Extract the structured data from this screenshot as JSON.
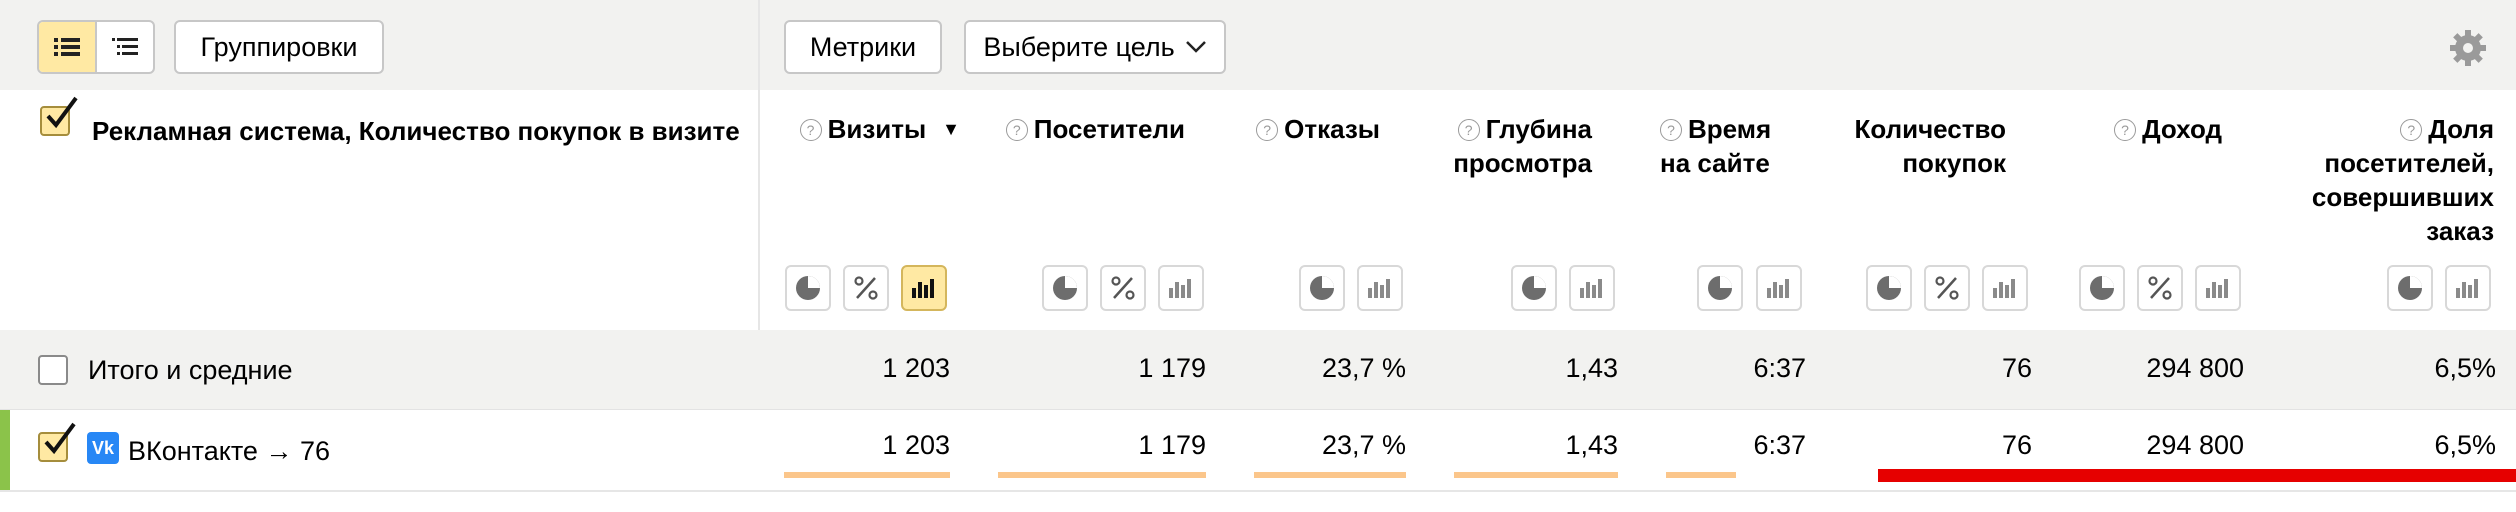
{
  "toolbar": {
    "view_list_icon": "list-icon",
    "view_tree_icon": "tree-icon",
    "groupings_label": "Группировки",
    "metrics_label": "Метрики",
    "goal_label": "Выберите цель",
    "settings_icon": "gear-icon"
  },
  "header": {
    "grouping_title": "Рекламная система, Количество покупок в визите",
    "columns": [
      {
        "title": "Визиты",
        "help": "?",
        "sort": "▼"
      },
      {
        "title": "Посетители",
        "help": "?"
      },
      {
        "title": "Отказы",
        "help": "?"
      },
      {
        "title_l1": "Глубина",
        "title_l2": "просмотра",
        "help": "?"
      },
      {
        "title_l1": "Время",
        "title_l2": "на сайте",
        "help": "?"
      },
      {
        "title_l1": "Количество",
        "title_l2": "покупок"
      },
      {
        "title": "Доход",
        "help": "?"
      },
      {
        "title_l1": "Доля",
        "title_l2": "посетителей,",
        "title_l3": "совершивших",
        "title_l4": "заказ",
        "help": "?"
      }
    ]
  },
  "rows": {
    "total": {
      "label": "Итого и средние",
      "values": [
        "1 203",
        "1 179",
        "23,7 %",
        "1,43",
        "6:37",
        "76",
        "294 800",
        "6,5%"
      ]
    },
    "data": [
      {
        "label": "ВКонтакте → 76",
        "icon_text": "Vk",
        "values": [
          "1 203",
          "1 179",
          "23,7 %",
          "1,43",
          "6:37",
          "76",
          "294 800",
          "6,5%"
        ],
        "bar_fill": [
          1.0,
          1.0,
          1.0,
          1.0,
          0.5,
          1.0,
          1.0,
          1.0
        ]
      }
    ]
  },
  "colors": {
    "accent_yellow": "#ffe9a3",
    "bar_orange": "#fbc68b",
    "highlight_red": "#e60000",
    "row_marker_green": "#8bc34a"
  }
}
